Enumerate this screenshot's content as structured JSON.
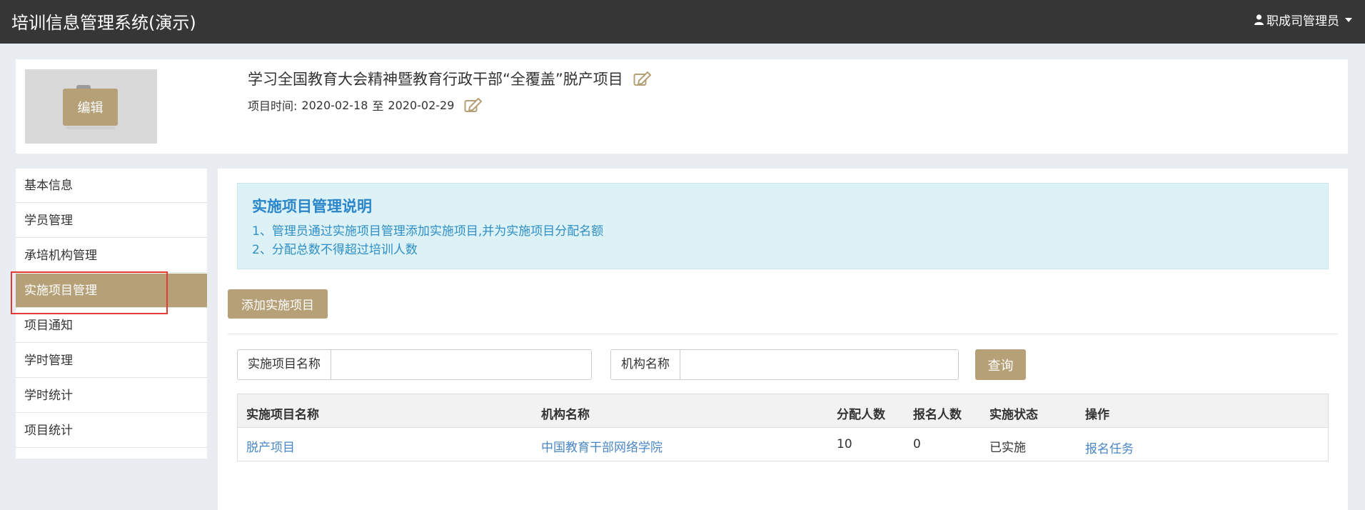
{
  "app": {
    "title": "培训信息管理系统(演示)",
    "user": "职成司管理员"
  },
  "project": {
    "thumb_edit_label": "编辑",
    "title": "学习全国教育大会精神暨教育行政干部“全覆盖”脱产项目",
    "time_label": "项目时间:",
    "start_date": "2020-02-18",
    "date_sep": "至",
    "end_date": "2020-02-29"
  },
  "sidebar": {
    "items": [
      {
        "label": "基本信息"
      },
      {
        "label": "学员管理"
      },
      {
        "label": "承培机构管理"
      },
      {
        "label": "实施项目管理"
      },
      {
        "label": "项目通知"
      },
      {
        "label": "学时管理"
      },
      {
        "label": "学时统计"
      },
      {
        "label": "项目统计"
      }
    ],
    "active_index": 3
  },
  "info": {
    "title": "实施项目管理说明",
    "line1": "1、管理员通过实施项目管理添加实施项目,并为实施项目分配名额",
    "line2": "2、分配总数不得超过培训人数"
  },
  "toolbar": {
    "add_label": "添加实施项目"
  },
  "search": {
    "project_name_label": "实施项目名称",
    "project_name_value": "",
    "org_name_label": "机构名称",
    "org_name_value": "",
    "query_label": "查询"
  },
  "table": {
    "headers": [
      "实施项目名称",
      "机构名称",
      "分配人数",
      "报名人数",
      "实施状态",
      "操作"
    ],
    "rows": [
      {
        "project_name": "脱产项目",
        "org_name": "中国教育干部网络学院",
        "allocated": "10",
        "enrolled": "0",
        "status": "已实施",
        "action": "报名任务"
      }
    ]
  },
  "colors": {
    "accent": "#b5a077",
    "topbar": "#363636",
    "link": "#4a86c5",
    "info_bg": "#dcf2f7",
    "info_text": "#2a86c9",
    "highlight": "#e53935"
  }
}
